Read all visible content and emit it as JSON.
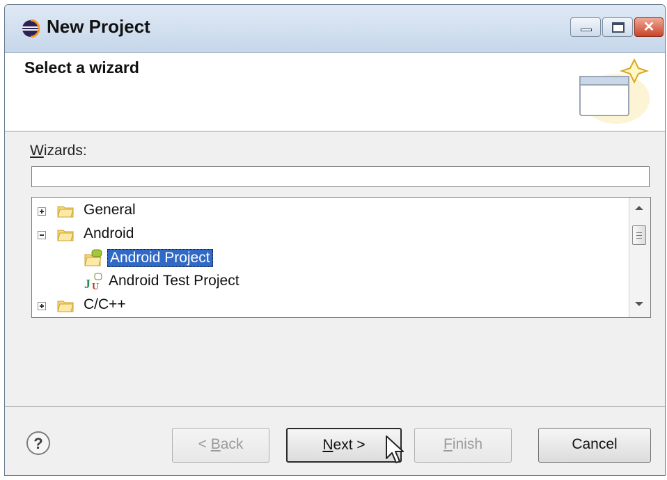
{
  "window": {
    "title": "New Project",
    "icon": "eclipse-icon",
    "controls": [
      "minimize-icon",
      "maximize-icon",
      "close-icon"
    ]
  },
  "header": {
    "title": "Select a wizard",
    "banner_icon": "new-wizard-icon"
  },
  "wizards": {
    "label_mnemonic": "W",
    "label_rest": "izards:",
    "filter_value": "",
    "tree": [
      {
        "label": "General",
        "level": 0,
        "expanded": false,
        "icon": "folder-icon"
      },
      {
        "label": "Android",
        "level": 0,
        "expanded": true,
        "icon": "folder-icon"
      },
      {
        "label": "Android Project",
        "level": 1,
        "selected": true,
        "icon": "android-project-icon"
      },
      {
        "label": "Android Test Project",
        "level": 1,
        "selected": false,
        "icon": "junit-icon"
      },
      {
        "label": "C/C++",
        "level": 0,
        "expanded": false,
        "icon": "folder-icon"
      }
    ]
  },
  "footer": {
    "help_icon": "help-icon",
    "back": {
      "pre": "< ",
      "mnemonic": "B",
      "rest": "ack",
      "enabled": false
    },
    "next": {
      "mnemonic": "N",
      "rest": "ext >",
      "enabled": true
    },
    "finish": {
      "mnemonic": "F",
      "rest": "inish",
      "enabled": false
    },
    "cancel": {
      "label": "Cancel",
      "enabled": true
    }
  },
  "colors": {
    "selection": "#3169c6",
    "titlebar": "#c6d7ea",
    "close_button": "#c9442a"
  }
}
